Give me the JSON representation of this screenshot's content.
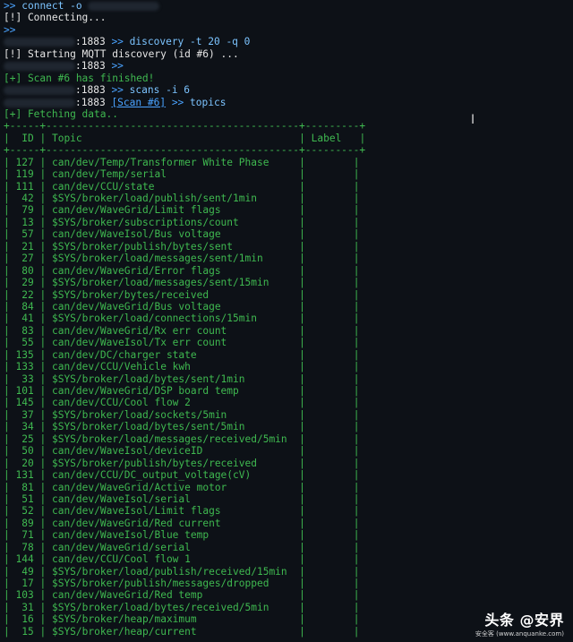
{
  "terminal": {
    "prompt": ">>",
    "connect_cmd": "connect -o ",
    "connecting": "[!] Connecting...",
    "port": ":1883",
    "discovery_cmd": "discovery -t 20 -q 0",
    "starting": "[!] Starting MQTT discovery (id #6) ...",
    "scan_finished": "[+] Scan #6 has finished!",
    "scans_cmd": "scans -i 6",
    "scan_tag": "[Scan #6]",
    "topics_cmd": "topics",
    "fetching": "[+] Fetching data.."
  },
  "table": {
    "border_top": "+-----+------------------------------------------+---------+",
    "headers": {
      "id": "ID",
      "topic": "Topic",
      "label": "Label"
    },
    "rows": [
      {
        "id": "127",
        "topic": "can/dev/Temp/Transformer White Phase"
      },
      {
        "id": "119",
        "topic": "can/dev/Temp/serial"
      },
      {
        "id": "111",
        "topic": "can/dev/CCU/state"
      },
      {
        "id": "42",
        "topic": "$SYS/broker/load/publish/sent/1min"
      },
      {
        "id": "79",
        "topic": "can/dev/WaveGrid/Limit flags"
      },
      {
        "id": "13",
        "topic": "$SYS/broker/subscriptions/count"
      },
      {
        "id": "57",
        "topic": "can/dev/WaveIsol/Bus voltage"
      },
      {
        "id": "21",
        "topic": "$SYS/broker/publish/bytes/sent"
      },
      {
        "id": "27",
        "topic": "$SYS/broker/load/messages/sent/1min"
      },
      {
        "id": "80",
        "topic": "can/dev/WaveGrid/Error flags"
      },
      {
        "id": "29",
        "topic": "$SYS/broker/load/messages/sent/15min"
      },
      {
        "id": "22",
        "topic": "$SYS/broker/bytes/received"
      },
      {
        "id": "84",
        "topic": "can/dev/WaveGrid/Bus voltage"
      },
      {
        "id": "41",
        "topic": "$SYS/broker/load/connections/15min"
      },
      {
        "id": "83",
        "topic": "can/dev/WaveGrid/Rx err count"
      },
      {
        "id": "55",
        "topic": "can/dev/WaveIsol/Tx err count"
      },
      {
        "id": "135",
        "topic": "can/dev/DC/charger state"
      },
      {
        "id": "133",
        "topic": "can/dev/CCU/Vehicle kwh"
      },
      {
        "id": "33",
        "topic": "$SYS/broker/load/bytes/sent/1min"
      },
      {
        "id": "101",
        "topic": "can/dev/WaveGrid/DSP board temp"
      },
      {
        "id": "145",
        "topic": "can/dev/CCU/Cool flow 2"
      },
      {
        "id": "37",
        "topic": "$SYS/broker/load/sockets/5min"
      },
      {
        "id": "34",
        "topic": "$SYS/broker/load/bytes/sent/5min"
      },
      {
        "id": "25",
        "topic": "$SYS/broker/load/messages/received/5min"
      },
      {
        "id": "50",
        "topic": "can/dev/WaveIsol/deviceID"
      },
      {
        "id": "20",
        "topic": "$SYS/broker/publish/bytes/received"
      },
      {
        "id": "131",
        "topic": "can/dev/CCU/DC_output_voltage(cV)"
      },
      {
        "id": "81",
        "topic": "can/dev/WaveGrid/Active motor"
      },
      {
        "id": "51",
        "topic": "can/dev/WaveIsol/serial"
      },
      {
        "id": "52",
        "topic": "can/dev/WaveIsol/Limit flags"
      },
      {
        "id": "89",
        "topic": "can/dev/WaveGrid/Red current"
      },
      {
        "id": "71",
        "topic": "can/dev/WaveIsol/Blue temp"
      },
      {
        "id": "78",
        "topic": "can/dev/WaveGrid/serial"
      },
      {
        "id": "144",
        "topic": "can/dev/CCU/Cool flow 1"
      },
      {
        "id": "49",
        "topic": "$SYS/broker/load/publish/received/15min"
      },
      {
        "id": "17",
        "topic": "$SYS/broker/publish/messages/dropped"
      },
      {
        "id": "103",
        "topic": "can/dev/WaveGrid/Red temp"
      },
      {
        "id": "31",
        "topic": "$SYS/broker/load/bytes/received/5min"
      },
      {
        "id": "16",
        "topic": "$SYS/broker/heap/maximum"
      },
      {
        "id": "15",
        "topic": "$SYS/broker/heap/current"
      }
    ]
  },
  "watermark": {
    "main": "头条 @安界",
    "sub": "安全客 (www.anquanke.com)"
  },
  "colors": {
    "background": "#0d1117",
    "green": "#3fb950",
    "blue": "#4aa3ff"
  }
}
